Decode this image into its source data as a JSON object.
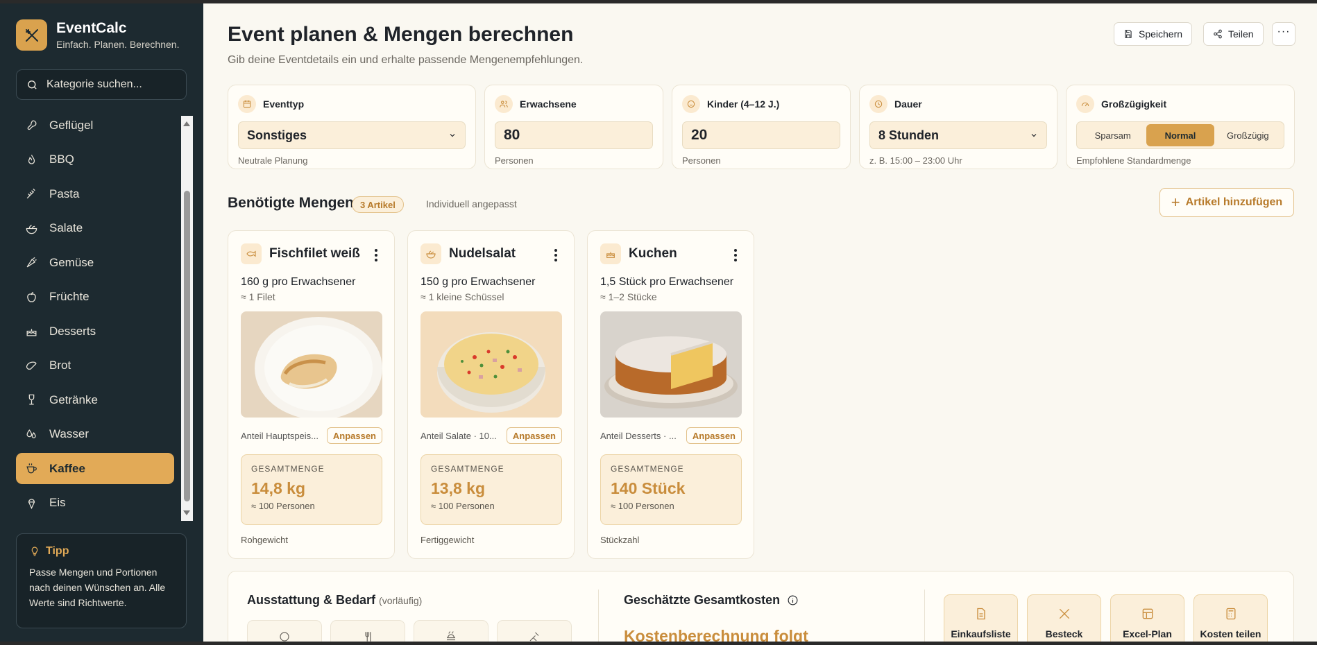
{
  "brand": {
    "name": "EventCalc",
    "tagline": "Einfach. Planen. Berechnen."
  },
  "search": {
    "placeholder": "Kategorie suchen..."
  },
  "sidebar": {
    "items": [
      {
        "label": "Geflügel",
        "icon": "drumstick-icon"
      },
      {
        "label": "BBQ",
        "icon": "flame-icon"
      },
      {
        "label": "Pasta",
        "icon": "wheat-icon"
      },
      {
        "label": "Salate",
        "icon": "salad-icon"
      },
      {
        "label": "Gemüse",
        "icon": "carrot-icon"
      },
      {
        "label": "Früchte",
        "icon": "apple-icon"
      },
      {
        "label": "Desserts",
        "icon": "cake-icon"
      },
      {
        "label": "Brot",
        "icon": "bread-icon"
      },
      {
        "label": "Getränke",
        "icon": "wine-icon"
      },
      {
        "label": "Wasser",
        "icon": "droplets-icon"
      },
      {
        "label": "Kaffee",
        "icon": "coffee-icon",
        "active": true
      },
      {
        "label": "Eis",
        "icon": "ice-cream-icon"
      }
    ]
  },
  "tip": {
    "title": "Tipp",
    "text": "Passe Mengen und Portionen nach deinen Wünschen an. Alle Werte sind Richtwerte."
  },
  "header": {
    "title": "Event planen & Mengen berechnen",
    "subtitle": "Gib deine Eventdetails ein und erhalte passende Mengenempfehlungen.",
    "save": "Speichern",
    "share": "Teilen"
  },
  "params": {
    "eventtype": {
      "label": "Eventtyp",
      "value": "Sonstiges",
      "hint": "Neutrale Planung"
    },
    "adults": {
      "label": "Erwachsene",
      "value": "80",
      "hint": "Personen"
    },
    "kids": {
      "label": "Kinder (4–12 J.)",
      "value": "20",
      "hint": "Personen"
    },
    "duration": {
      "label": "Dauer",
      "value": "8 Stunden",
      "hint": "z. B. 15:00 – 23:00 Uhr"
    },
    "generosity": {
      "label": "Großzügigkeit",
      "options": [
        "Sparsam",
        "Normal",
        "Großzügig"
      ],
      "selected": "Normal",
      "hint": "Empfohlene Standardmenge"
    }
  },
  "section": {
    "title": "Benötigte Mengen",
    "badge": "3 Artikel",
    "note": "Individuell angepasst",
    "add": "Artikel hinzufügen"
  },
  "cards": [
    {
      "name": "Fischfilet weiß",
      "icon": "fish-icon",
      "per": "160 g pro Erwachsener",
      "approx": "≈ 1 Filet",
      "share": "Anteil Hauptspeis...",
      "adjust": "Anpassen",
      "total_label": "GESAMTMENGE",
      "total": "14,8 kg",
      "people": "≈ 100 Personen",
      "foot": "Rohgewicht"
    },
    {
      "name": "Nudelsalat",
      "icon": "salad-icon",
      "per": "150 g pro Erwachsener",
      "approx": "≈ 1 kleine Schüssel",
      "share": "Anteil Salate · 10...",
      "adjust": "Anpassen",
      "total_label": "GESAMTMENGE",
      "total": "13,8 kg",
      "people": "≈ 100 Personen",
      "foot": "Fertiggewicht"
    },
    {
      "name": "Kuchen",
      "icon": "cake-icon",
      "per": "1,5 Stück pro Erwachsener",
      "approx": "≈ 1–2 Stücke",
      "share": "Anteil Desserts · ...",
      "adjust": "Anpassen",
      "total_label": "GESAMTMENGE",
      "total": "140 Stück",
      "people": "≈ 100 Personen",
      "foot": "Stückzahl"
    }
  ],
  "equipment": {
    "title": "Ausstattung & Bedarf",
    "sub": "(vorläufig)"
  },
  "cost": {
    "title": "Geschätzte Gesamtkosten",
    "value": "Kostenberechnung folgt"
  },
  "exports": [
    {
      "label": "Einkaufsliste PDF",
      "icon": "file-icon"
    },
    {
      "label": "Besteck",
      "icon": "utensils-icon"
    },
    {
      "label": "Excel-Plan",
      "icon": "table-icon"
    },
    {
      "label": "Kosten teilen",
      "icon": "calculator-icon"
    }
  ],
  "colors": {
    "accent": "#d9a24e",
    "sidebar": "#1d2a30",
    "background": "#faf8f1"
  }
}
